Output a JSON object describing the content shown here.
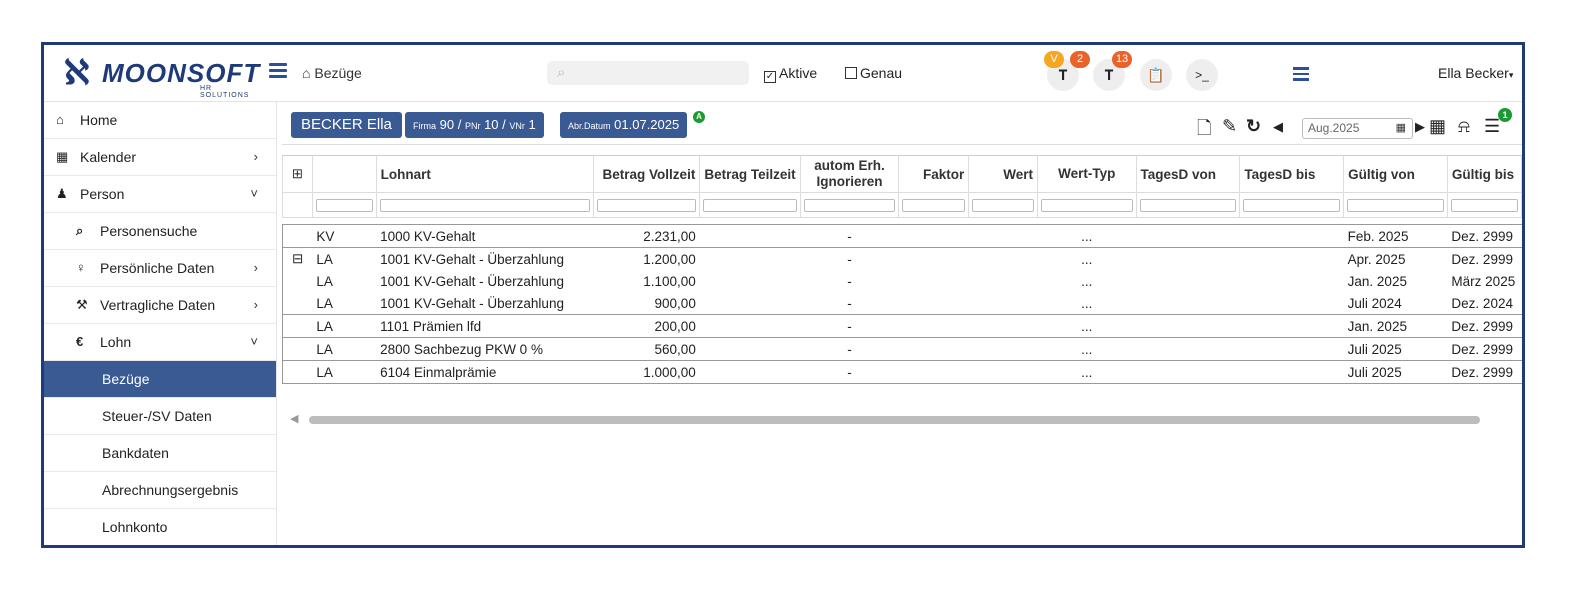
{
  "app": {
    "logo_text": "MOONSOFT",
    "logo_sub": "HR SOLUTIONS",
    "breadcrumb": "Bezüge",
    "search_placeholder": "",
    "filters": [
      {
        "label": "Aktive",
        "checked": true
      },
      {
        "label": "Genau",
        "checked": false
      }
    ],
    "badges": [
      {
        "value": "V",
        "color": "#f5a623"
      },
      {
        "value": "2",
        "color": "#e8622a"
      },
      {
        "value": "13",
        "color": "#e8622a"
      }
    ],
    "terminal_label": ">_",
    "user": "Ella Becker"
  },
  "sidebar": {
    "items": [
      {
        "label": "Home",
        "icon": "home-icon",
        "glyph": "⌂"
      },
      {
        "label": "Kalender",
        "icon": "calendar-icon",
        "glyph": "▦",
        "arrow": "›"
      },
      {
        "label": "Person",
        "icon": "person-icon",
        "glyph": "♟",
        "arrow": "˅"
      },
      {
        "label": "Personensuche",
        "icon": "search-icon",
        "glyph": "⌕"
      },
      {
        "label": "Persönliche Daten",
        "icon": "person-standing-icon",
        "glyph": "♀",
        "arrow": "›"
      },
      {
        "label": "Vertragliche Daten",
        "icon": "gavel-icon",
        "glyph": "⚒",
        "arrow": "›"
      },
      {
        "label": "Lohn",
        "icon": "euro-icon",
        "glyph": "€",
        "arrow": "˅"
      },
      {
        "label": "Bezüge"
      },
      {
        "label": "Steuer-/SV Daten"
      },
      {
        "label": "Bankdaten"
      },
      {
        "label": "Abrechnungsergebnis"
      },
      {
        "label": "Lohnkonto"
      }
    ]
  },
  "context": {
    "employee": "BECKER Ella",
    "firma_label": "Firma",
    "firma": "90",
    "pnr_label": "PNr",
    "pnr": "10",
    "vnr_label": "VNr",
    "vnr": "1",
    "abr_label": "Abr.Datum",
    "abr_date": "01.07.2025",
    "abr_badge": "A",
    "period": "Aug.2025",
    "list_badge": "1"
  },
  "table": {
    "columns": [
      "Lohnart",
      "Betrag Vollzeit",
      "Betrag Teilzeit",
      "autom Erh. Ignorieren",
      "Faktor",
      "Wert",
      "Wert-Typ",
      "TagesD von",
      "TagesD bis",
      "Gültig von",
      "Gültig bis"
    ],
    "rows": [
      {
        "toggle": "",
        "typ": "KV",
        "lohnart": "1000 KV-Gehalt",
        "vollzeit": "2.231,00",
        "teilzeit": "",
        "autom": "-",
        "faktor": "",
        "wert": "",
        "werttyp": "...",
        "tvon": "",
        "tbis": "",
        "gvon": "Feb. 2025",
        "gbis": "Dez. 2999",
        "gtop": true,
        "gbot": true
      },
      {
        "toggle": "⊟",
        "typ": "LA",
        "lohnart": "1001 KV-Gehalt - Überzahlung",
        "vollzeit": "1.200,00",
        "teilzeit": "",
        "autom": "-",
        "faktor": "",
        "wert": "",
        "werttyp": "...",
        "tvon": "",
        "tbis": "",
        "gvon": "Apr. 2025",
        "gbis": "Dez. 2999",
        "gtop": true,
        "gbot": false
      },
      {
        "toggle": "",
        "typ": "LA",
        "lohnart": "1001 KV-Gehalt - Überzahlung",
        "vollzeit": "1.100,00",
        "teilzeit": "",
        "autom": "-",
        "faktor": "",
        "wert": "",
        "werttyp": "...",
        "tvon": "",
        "tbis": "",
        "gvon": "Jan. 2025",
        "gbis": "März 2025",
        "gtop": false,
        "gbot": false
      },
      {
        "toggle": "",
        "typ": "LA",
        "lohnart": "1001 KV-Gehalt - Überzahlung",
        "vollzeit": "900,00",
        "teilzeit": "",
        "autom": "-",
        "faktor": "",
        "wert": "",
        "werttyp": "...",
        "tvon": "",
        "tbis": "",
        "gvon": "Juli 2024",
        "gbis": "Dez. 2024",
        "gtop": false,
        "gbot": true
      },
      {
        "toggle": "",
        "typ": "LA",
        "lohnart": "1101 Prämien lfd",
        "vollzeit": "200,00",
        "teilzeit": "",
        "autom": "-",
        "faktor": "",
        "wert": "",
        "werttyp": "...",
        "tvon": "",
        "tbis": "",
        "gvon": "Jan. 2025",
        "gbis": "Dez. 2999",
        "gtop": true,
        "gbot": true
      },
      {
        "toggle": "",
        "typ": "LA",
        "lohnart": "2800 Sachbezug PKW 0 %",
        "vollzeit": "560,00",
        "teilzeit": "",
        "autom": "-",
        "faktor": "",
        "wert": "",
        "werttyp": "...",
        "tvon": "",
        "tbis": "",
        "gvon": "Juli 2025",
        "gbis": "Dez. 2999",
        "gtop": true,
        "gbot": true
      },
      {
        "toggle": "",
        "typ": "LA",
        "lohnart": "6104 Einmalprämie",
        "vollzeit": "1.000,00",
        "teilzeit": "",
        "autom": "-",
        "faktor": "",
        "wert": "",
        "werttyp": "...",
        "tvon": "",
        "tbis": "",
        "gvon": "Juli 2025",
        "gbis": "Dez. 2999",
        "gtop": true,
        "gbot": true
      }
    ]
  }
}
